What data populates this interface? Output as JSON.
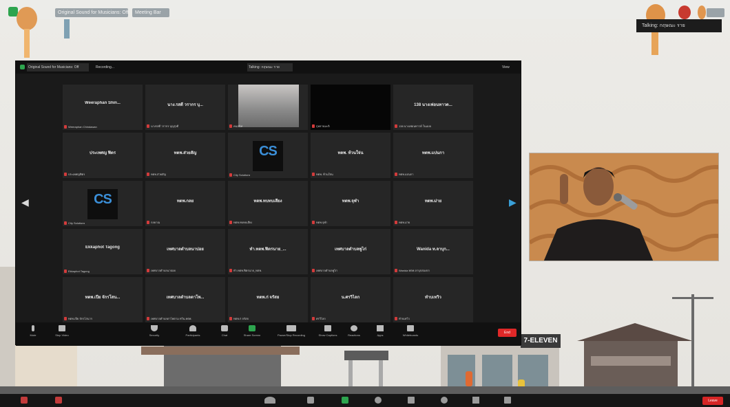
{
  "outer": {
    "title_chips": [
      "Original Sound for Musicians: Off",
      "Meeting Bar"
    ],
    "name_tag": "Talking: กฤษณะ ราย",
    "leave_label": "Leave",
    "mic_chip": "Mic"
  },
  "zoom_window": {
    "sound_chip": "Original Sound for Musicians: Off",
    "recording_chip": "Recording...",
    "talking_chip": "Talking: กฤษณะ ราย",
    "view_label": "View"
  },
  "tiles": [
    {
      "name": "Weeraphan Shin...",
      "label": "Weeraphan Chindawan",
      "kind": "name"
    },
    {
      "name": "นาง.รสดี วรากร บุ...",
      "label": "นางรสดี วรากร บุญรุ่งดี",
      "kind": "name"
    },
    {
      "name": "",
      "label": "คนสนิท",
      "kind": "video"
    },
    {
      "name": "",
      "label": "กุหลาบมะลิ",
      "kind": "black"
    },
    {
      "name": "138 นางเฟอนทาวด...",
      "label": "138 นางเฟอนทาวด์ ในแบบ",
      "kind": "name"
    },
    {
      "name": "ประเทศญ ฟิตร",
      "label": "ประเทศญฟิตร",
      "kind": "name"
    },
    {
      "name": "ทตพ.ส่วยสัญ",
      "label": "ทตพ.ส่วยสัญ",
      "kind": "name"
    },
    {
      "name": "",
      "label": "City Solutions",
      "kind": "cs"
    },
    {
      "name": "ทตพ. ท้วนใจ่น",
      "label": "ทตพ. ท้วนใจ่น",
      "kind": "name"
    },
    {
      "name": "ทตพ.แบ่นกา",
      "label": "ทตพ.แบ่นกา",
      "kind": "name"
    },
    {
      "name": "",
      "label": "City Solutions",
      "kind": "cs"
    },
    {
      "name": "ทตพ.กลย",
      "label": "กลยาณ",
      "kind": "name"
    },
    {
      "name": "ทตพ.ทบทบเสียง",
      "label": "ทตพ.ทบทบเสียง",
      "kind": "name"
    },
    {
      "name": "ทตพ.จุฬา",
      "label": "ทตพ.จุฬา",
      "kind": "name"
    },
    {
      "name": "ทตพ.ม่าย",
      "label": "ทตพ.ม่าย",
      "kind": "name"
    },
    {
      "name": "Ekkaphot Tagong",
      "label": "Ekkaphot Tagong",
      "kind": "name"
    },
    {
      "name": "เทศบาลตำบลนาบ่อย",
      "label": "เทศบาลตำบลนาบ่อย",
      "kind": "name"
    },
    {
      "name": "ทำ.ทตพ.ฟิตรนาย_...",
      "label": "ทำ.ทตพ.ฟิตรนาย_ทตพ.",
      "kind": "name"
    },
    {
      "name": "เทศบาลตำบลพูไก่",
      "label": "เทศบาลตำบลพูไก่",
      "kind": "name"
    },
    {
      "name": "Wanida ท.ลาบุก...",
      "label": "Wanida ทตพ.ลาบุกสองกก",
      "kind": "name"
    },
    {
      "name": "ทตพ.เปีย จักรโสน...",
      "label": "ทตพ.เปีย จักรโสนาร",
      "kind": "name"
    },
    {
      "name": "เทศบาลตำบลตาโพ...",
      "label": "เทศบาลตำบลตาโพตาม ทวิน.ทตพ.",
      "kind": "name"
    },
    {
      "name": "ทตพ.ก่ จรัสย",
      "label": "ทตพ.ก่ จรัสย",
      "kind": "name"
    },
    {
      "name": "น.ศรวิไลก",
      "label": "ศรวิไลก",
      "kind": "name"
    },
    {
      "name": "ทำบเทวิว",
      "label": "ทำบเทวิว",
      "kind": "name"
    }
  ],
  "toolbar": {
    "items": [
      "Mute",
      "Stop Video",
      "Security",
      "Participants",
      "Chat",
      "Share Screen",
      "Pause/Stop Recording",
      "Show Captions",
      "Reactions",
      "Apps",
      "Whiteboards"
    ],
    "participants_count": "25",
    "end_label": "End"
  },
  "store_sign": "7-ELEVEN",
  "colors": {
    "end_red": "#e02828",
    "accent_green": "#2da44e",
    "accent_blue": "#3b8fd8"
  }
}
